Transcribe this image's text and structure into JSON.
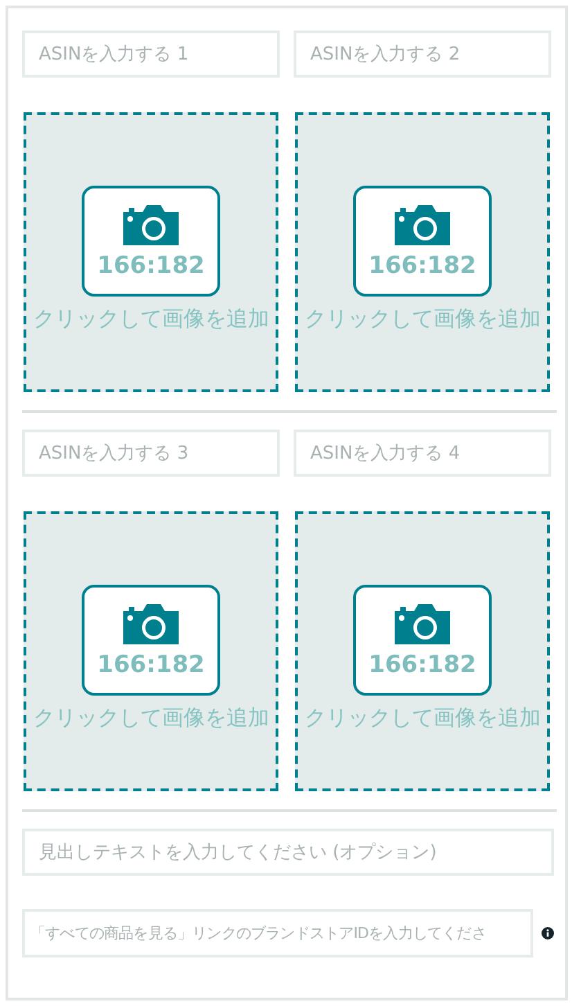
{
  "groups": [
    {
      "asin_fields": [
        {
          "placeholder": "ASINを入力する 1"
        },
        {
          "placeholder": "ASINを入力する 2"
        }
      ],
      "tiles": [
        {
          "ratio": "166:182",
          "label": "クリックして画像を追加"
        },
        {
          "ratio": "166:182",
          "label": "クリックして画像を追加"
        }
      ]
    },
    {
      "asin_fields": [
        {
          "placeholder": "ASINを入力する 3"
        },
        {
          "placeholder": "ASINを入力する 4"
        }
      ],
      "tiles": [
        {
          "ratio": "166:182",
          "label": "クリックして画像を追加"
        },
        {
          "ratio": "166:182",
          "label": "クリックして画像を追加"
        }
      ]
    }
  ],
  "headline_field": {
    "placeholder": "見出しテキストを入力してください (オプション)"
  },
  "store_id_field": {
    "placeholder": "「すべての商品を見る」リンクのブランドストアIDを入力してくださ"
  }
}
